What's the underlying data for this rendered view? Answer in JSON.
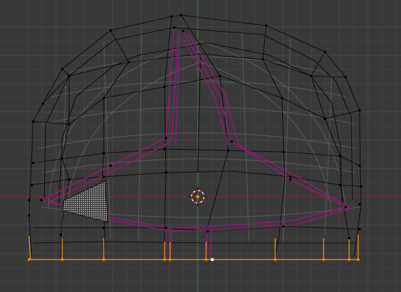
{
  "viewport": {
    "view": "front-orthographic",
    "mode": "edit-mode",
    "selection": "face-select"
  },
  "colors": {
    "background": "#393939",
    "grid_minor": "#404040",
    "grid_major": "#474747",
    "x_axis": "#7a2a2a",
    "z_axis": "#2e8a2e",
    "wire": "#111111",
    "wire_hidden": "#5a5a5a",
    "seam": "#8a1d6e",
    "selected_edge": "#e08a10",
    "vertex": "#000000",
    "active_vertex": "#ffffff",
    "cursor_ring_a": "#ffffff",
    "cursor_ring_b": "#d23a2a"
  }
}
